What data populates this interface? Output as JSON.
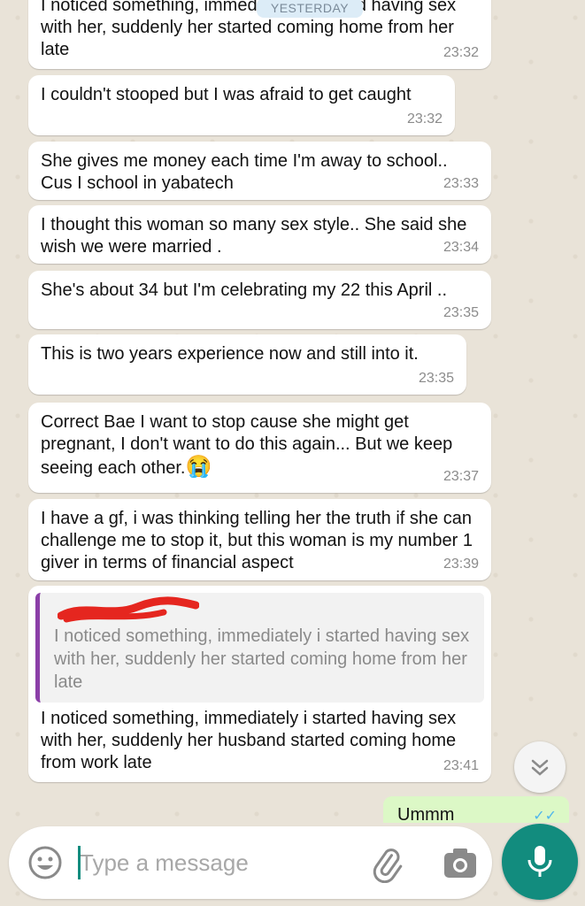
{
  "chat": {
    "date_label": "YESTERDAY",
    "messages": [
      {
        "text": "I noticed something, immediately i started having sex with her, suddenly her started coming home from her late",
        "time": "23:32"
      },
      {
        "text": "I couldn't stooped but I was afraid to get caught",
        "time": "23:32"
      },
      {
        "text": "She gives me money each time I'm away to school.. Cus I school in yabatech",
        "time": "23:33"
      },
      {
        "text": "I thought this woman so many sex style.. She said she wish we were married .",
        "time": "23:34"
      },
      {
        "text": "She's about 34 but I'm celebrating my 22 this April ..",
        "time": "23:35"
      },
      {
        "text": "This is two years experience now and still into it.",
        "time": "23:35"
      },
      {
        "text": "Correct Bae I want to stop cause she might get pregnant, I don't want to do this again... But we keep seeing each other.",
        "emoji": "😭",
        "time": "23:37"
      },
      {
        "text": "I have a gf, i was thinking telling her the truth if she can challenge me to stop it, but this woman is my number 1 giver in terms of financial aspect",
        "time": "23:39"
      },
      {
        "quoted_text": "I noticed something, immediately i started having sex with her, suddenly her started coming home from her late",
        "text": "I noticed something, immediately i started having sex with her, suddenly her husband started coming home from work late",
        "time": "23:41"
      }
    ],
    "sent_preview": "Ummm"
  },
  "composer": {
    "placeholder": "Type a message"
  },
  "icons": {
    "emoji": "emoji-icon",
    "attach": "paperclip-icon",
    "camera": "camera-icon",
    "mic": "mic-icon",
    "scroll": "double-chevron-down-icon"
  },
  "colors": {
    "accent": "#128c7e",
    "bubble_in": "#ffffff",
    "bubble_out": "#dcf8c6",
    "quote_bar": "#8b3fa8",
    "background": "#e9e3d8"
  }
}
